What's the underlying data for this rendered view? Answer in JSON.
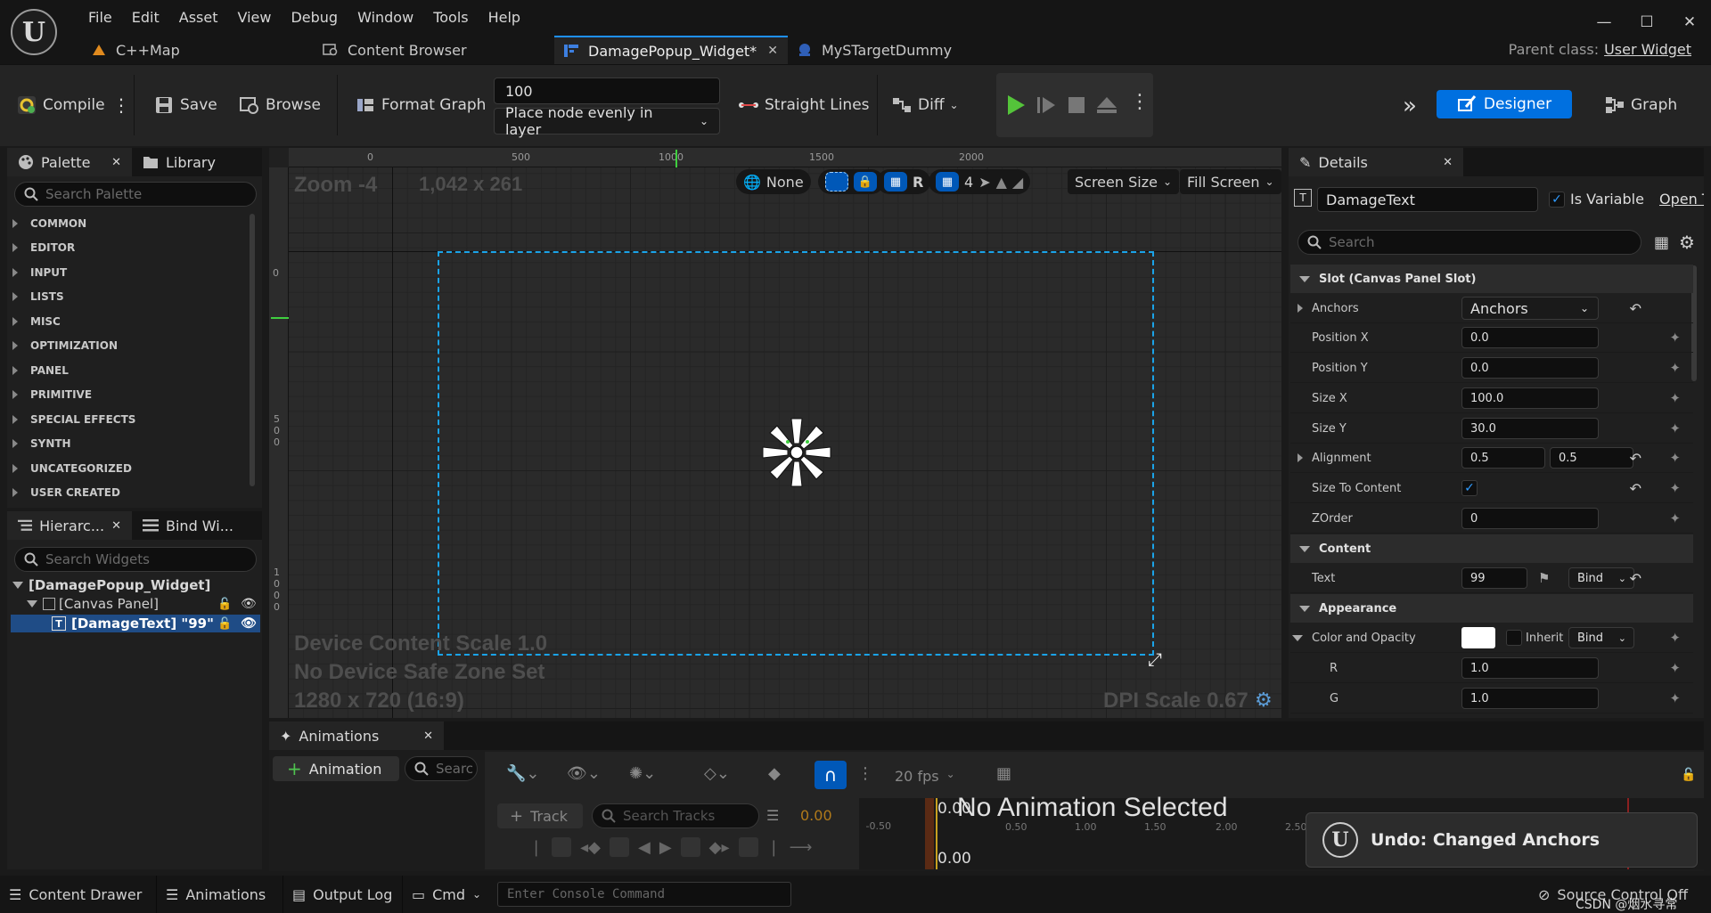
{
  "menu": [
    "File",
    "Edit",
    "Asset",
    "View",
    "Debug",
    "Window",
    "Tools",
    "Help"
  ],
  "tabs": [
    {
      "label": "C++Map",
      "active": false
    },
    {
      "label": "Content Browser",
      "active": false
    },
    {
      "label": "DamagePopup_Widget*",
      "active": true
    },
    {
      "label": "MySTargetDummy",
      "active": false
    }
  ],
  "parent_class": {
    "label": "Parent class:",
    "value": "User Widget"
  },
  "toolbar": {
    "compile": "Compile",
    "save": "Save",
    "browse": "Browse",
    "format_graph": "Format Graph",
    "spacing_value": "100",
    "node_mode": "Place node evenly in layer",
    "straight_lines": "Straight Lines",
    "diff": "Diff",
    "designer": "Designer",
    "graph": "Graph"
  },
  "palette": {
    "tab_palette": "Palette",
    "tab_library": "Library",
    "search_placeholder": "Search Palette",
    "categories": [
      "COMMON",
      "EDITOR",
      "INPUT",
      "LISTS",
      "MISC",
      "OPTIMIZATION",
      "PANEL",
      "PRIMITIVE",
      "SPECIAL EFFECTS",
      "SYNTH",
      "UNCATEGORIZED",
      "USER CREATED"
    ]
  },
  "hierarchy": {
    "tab_hierarchy": "Hierarc...",
    "tab_bind": "Bind Wi...",
    "search_placeholder": "Search Widgets",
    "root": "[DamagePopup_Widget]",
    "canvas": "[Canvas Panel]",
    "text": "[DamageText] \"99\""
  },
  "viewport": {
    "zoom": "Zoom -4",
    "size": "1,042 x 261",
    "none_label": "None",
    "r_label": "R",
    "grid_value": "4",
    "screen_size": "Screen Size",
    "fill_screen": "Fill Screen",
    "device_scale": "Device Content Scale 1.0",
    "safe_zone": "No Device Safe Zone Set",
    "resolution": "1280 x 720 (16:9)",
    "dpi_scale": "DPI Scale 0.67",
    "ruler_top": [
      "0",
      "500",
      "1000",
      "1500",
      "2000"
    ],
    "ruler_left": [
      "0",
      "5\n0\n0",
      "1\n0\n0\n0"
    ]
  },
  "details": {
    "tab": "Details",
    "name_value": "DamageText",
    "is_variable": "Is Variable",
    "open_link": "Open T",
    "search_placeholder": "Search",
    "sections": {
      "slot": "Slot (Canvas Panel Slot)",
      "content": "Content",
      "appearance": "Appearance"
    },
    "props": {
      "anchors_label": "Anchors",
      "anchors_value": "Anchors",
      "position_x_label": "Position X",
      "position_x": "0.0",
      "position_y_label": "Position Y",
      "position_y": "0.0",
      "size_x_label": "Size X",
      "size_x": "100.0",
      "size_y_label": "Size Y",
      "size_y": "30.0",
      "alignment_label": "Alignment",
      "alignment_x": "0.5",
      "alignment_y": "0.5",
      "size_to_content_label": "Size To Content",
      "zorder_label": "ZOrder",
      "zorder": "0",
      "text_label": "Text",
      "text_value": "99",
      "bind_label": "Bind",
      "color_label": "Color and Opacity",
      "inherit_label": "Inherit",
      "r_label": "R",
      "r_value": "1.0",
      "g_label": "G",
      "g_value": "1.0"
    }
  },
  "animations": {
    "tab": "Animations",
    "add_button": "Animation",
    "search_placeholder": "Searc",
    "fps": "20 fps",
    "track_button": "Track",
    "search_tracks": "Search Tracks",
    "time_value": "0.00",
    "timeline_start": "0.00",
    "timeline_end": "0.00",
    "no_animation": "No Animation Selected",
    "timeline_ticks": [
      "-0.50",
      "0.50",
      "1.00",
      "1.50",
      "2.00",
      "2.50"
    ]
  },
  "statusbar": {
    "content_drawer": "Content Drawer",
    "animations": "Animations",
    "output_log": "Output Log",
    "cmd": "Cmd",
    "console_placeholder": "Enter Console Command",
    "source_control": "Source Control Off",
    "watermark": "CSDN @烟水寻常"
  },
  "toast": {
    "message": "Undo: Changed Anchors"
  }
}
